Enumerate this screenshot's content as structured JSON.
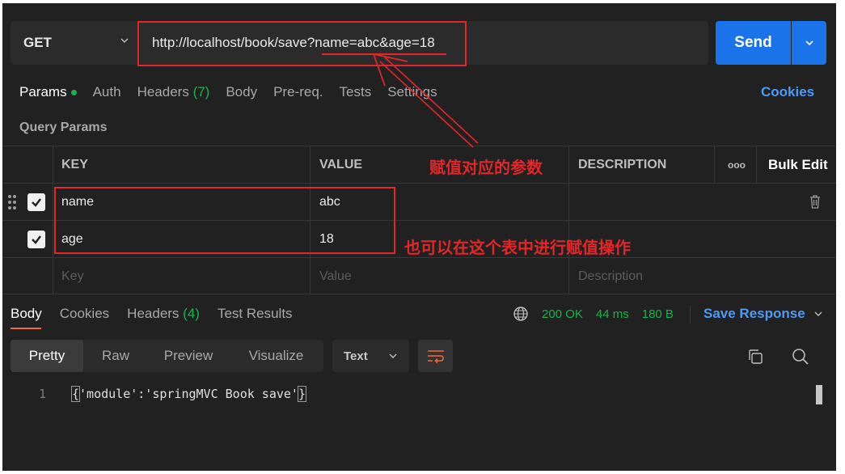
{
  "request": {
    "method": "GET",
    "url": "http://localhost/book/save?name=abc&age=18",
    "send_label": "Send"
  },
  "request_tabs": [
    {
      "label": "Params",
      "active": true,
      "dot": true
    },
    {
      "label": "Auth"
    },
    {
      "label": "Headers",
      "count": "(7)"
    },
    {
      "label": "Body"
    },
    {
      "label": "Pre-req."
    },
    {
      "label": "Tests"
    },
    {
      "label": "Settings"
    }
  ],
  "cookies_label": "Cookies",
  "query_params": {
    "title": "Query Params",
    "headers": {
      "key": "KEY",
      "value": "VALUE",
      "description": "DESCRIPTION",
      "more": "ooo",
      "bulk_edit": "Bulk Edit"
    },
    "rows": [
      {
        "key": "name",
        "value": "abc",
        "checked": true
      },
      {
        "key": "age",
        "value": "18",
        "checked": true
      }
    ],
    "placeholders": {
      "key": "Key",
      "value": "Value",
      "description": "Description"
    }
  },
  "response": {
    "tabs": [
      {
        "label": "Body",
        "active": true
      },
      {
        "label": "Cookies"
      },
      {
        "label": "Headers",
        "count": "(4)"
      },
      {
        "label": "Test Results"
      }
    ],
    "status": "200 OK",
    "time": "44 ms",
    "size": "180 B",
    "save_label": "Save Response",
    "view_modes": [
      "Pretty",
      "Raw",
      "Preview",
      "Visualize"
    ],
    "active_view": "Pretty",
    "format": "Text",
    "line_number": "1",
    "body_open": "{",
    "body_text": "'module':'springMVC Book save'",
    "body_close": "}"
  },
  "annotations": {
    "url_note": "赋值对应的参数",
    "table_note": "也可以在这个表中进行赋值操作",
    "color": "#e3262a"
  },
  "colors": {
    "accent_blue": "#1a73e8",
    "success_green": "#17b34b",
    "tab_underline": "#f26b3a",
    "background": "#212121"
  }
}
